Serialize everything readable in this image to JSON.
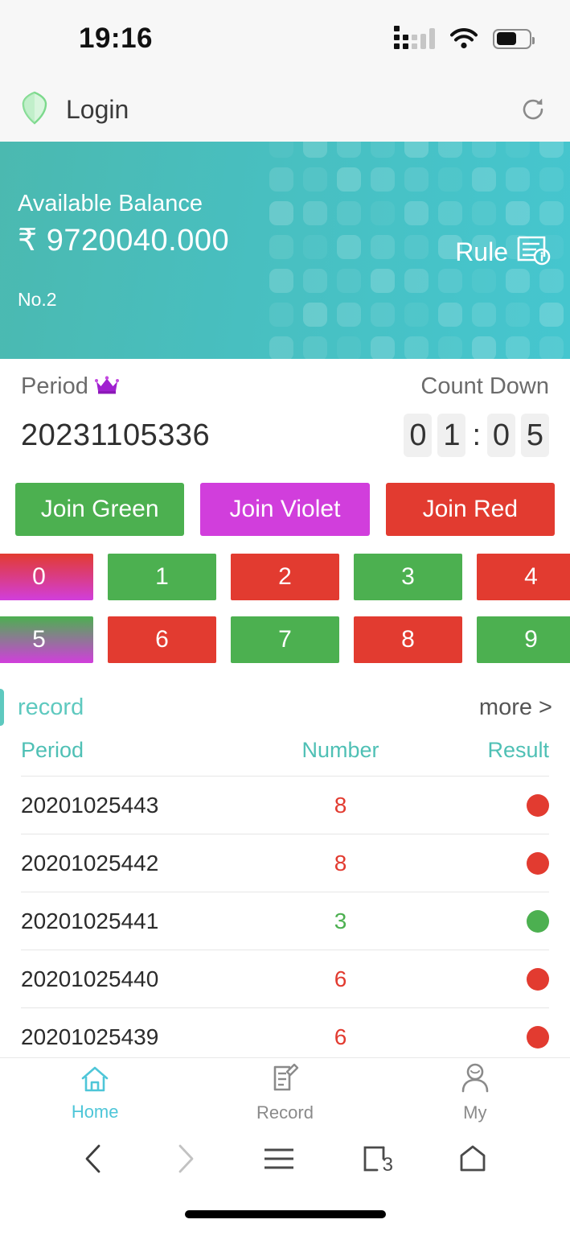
{
  "status_bar": {
    "time": "19:16",
    "signal_icon": "signal-dots-icon",
    "wifi_icon": "wifi-icon",
    "battery_icon": "battery-icon",
    "battery_level_pct": 62
  },
  "app_header": {
    "shield_icon": "shield-icon",
    "title": "Login",
    "refresh_icon": "refresh-icon"
  },
  "balance_card": {
    "label": "Available Balance",
    "amount": "₹ 9720040.000",
    "account_no": "No.2",
    "rule_label": "Rule",
    "rule_icon": "rule-document-info-icon",
    "gradient_from": "#4bb9b0",
    "gradient_to": "#45c6cf"
  },
  "period": {
    "label": "Period",
    "crown_icon": "crown-icon",
    "number": "20231105336",
    "countdown_label": "Count Down",
    "countdown": {
      "m1": "0",
      "m2": "1",
      "separator": ":",
      "s1": "0",
      "s2": "5"
    }
  },
  "join_buttons": [
    {
      "label": "Join Green",
      "color": "#4cb050",
      "name": "join-green-button"
    },
    {
      "label": "Join Violet",
      "color": "#d13edc",
      "name": "join-violet-button"
    },
    {
      "label": "Join Red",
      "color": "#e23b30",
      "name": "join-red-button"
    }
  ],
  "number_buttons": [
    {
      "label": "0",
      "style": "gradient-red-violet"
    },
    {
      "label": "1",
      "style": "green"
    },
    {
      "label": "2",
      "style": "red"
    },
    {
      "label": "3",
      "style": "green"
    },
    {
      "label": "4",
      "style": "red"
    },
    {
      "label": "5",
      "style": "gradient-green-violet"
    },
    {
      "label": "6",
      "style": "red"
    },
    {
      "label": "7",
      "style": "green"
    },
    {
      "label": "8",
      "style": "red"
    },
    {
      "label": "9",
      "style": "green"
    }
  ],
  "colors": {
    "green": "#4cb050",
    "red": "#e23b30",
    "violet": "#d13edc",
    "teal": "#4fc0b5",
    "accent_cyan": "#4ec6d8"
  },
  "record": {
    "title": "record",
    "more_label": "more >",
    "columns": [
      "Period",
      "Number",
      "Result"
    ],
    "rows": [
      {
        "period": "20201025443",
        "number": "8",
        "result": "red"
      },
      {
        "period": "20201025442",
        "number": "8",
        "result": "red"
      },
      {
        "period": "20201025441",
        "number": "3",
        "result": "green"
      },
      {
        "period": "20201025440",
        "number": "6",
        "result": "red"
      },
      {
        "period": "20201025439",
        "number": "6",
        "result": "red"
      }
    ]
  },
  "tab_bar": [
    {
      "label": "Home",
      "icon": "home-icon",
      "active": true
    },
    {
      "label": "Record",
      "icon": "record-document-icon",
      "active": false
    },
    {
      "label": "My",
      "icon": "person-icon",
      "active": false
    }
  ],
  "browser_nav": {
    "back_icon": "chevron-left-icon",
    "forward_icon": "chevron-right-icon",
    "menu_icon": "hamburger-menu-icon",
    "tabs_icon": "browser-tabs-icon",
    "tabs_count": "3",
    "home_icon": "browser-home-icon"
  }
}
